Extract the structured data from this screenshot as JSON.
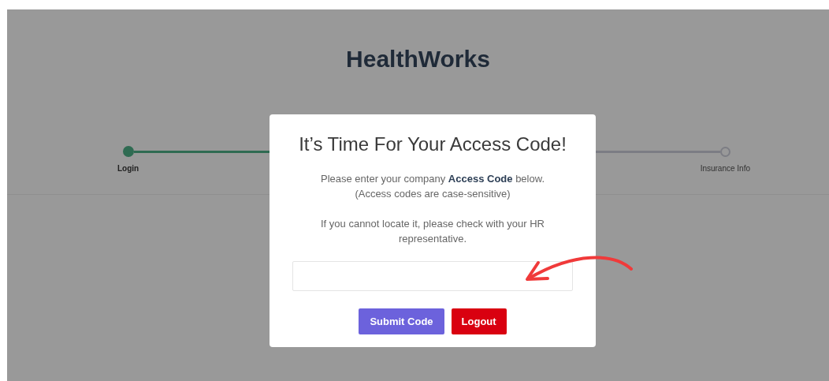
{
  "app": {
    "title": "HealthWorks"
  },
  "steps": [
    {
      "label": "Login",
      "done": true
    },
    {
      "label": "Insurance Info",
      "done": false
    }
  ],
  "dialog": {
    "title": "It’s Time For Your Access Code!",
    "message": "Please enter your company **Access Code** below.",
    "note": "(Access codes are case-sensitive)",
    "help": "If you cannot locate it, please check with your HR representative.",
    "buttons": [
      {
        "label": "Submit Code",
        "kind": "primary"
      },
      {
        "label": "Logout",
        "kind": "danger"
      }
    ]
  }
}
